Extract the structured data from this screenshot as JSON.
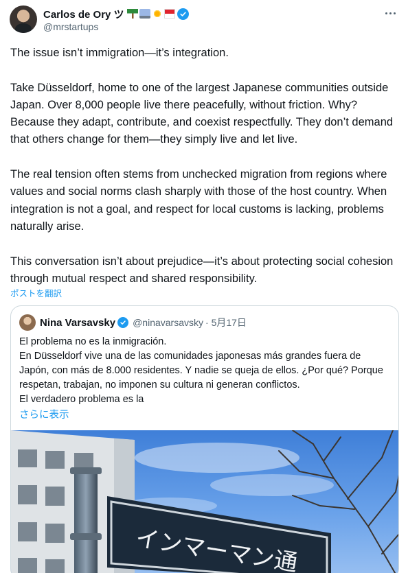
{
  "author": {
    "name": "Carlos de Ory ツ",
    "handle": "@mrstartups"
  },
  "tweet": {
    "paragraphs": [
      "The issue isn’t immigration—it’s integration.",
      "Take Düsseldorf, home to one of the largest Japanese communities outside Japan. Over 8,000 people live there peacefully, without friction. Why? Because they adapt, contribute, and coexist respectfully. They don’t demand that others change for them—they simply live and let live.",
      "The real tension often stems from unchecked migration from regions where values and social norms clash sharply with those of the host country. When integration is not a goal, and respect for local customs is lacking, problems naturally arise.",
      "This conversation isn’t about prejudice—it’s about protecting social cohesion through mutual respect and shared responsibility."
    ],
    "translate_label": "ポストを翻訳"
  },
  "quote": {
    "name": "Nina Varsavsky",
    "handle": "@ninavarsavsky",
    "date": "· 5月17日",
    "lines": [
      "El problema no es la inmigración.",
      "En Düsseldorf vive una de las comunidades japonesas más grandes fuera de Japón, con más de 8.000 residentes. Y nadie se queja de ellos. ¿Por qué? Porque respetan, trabajan, no imponen su cultura ni generan conflictos.",
      "El verdadero problema es la"
    ],
    "show_more": "さらに表示",
    "image": {
      "sign_text": "インマーマン通"
    }
  },
  "colors": {
    "accent": "#1d9bf0",
    "text": "#0f1419",
    "muted": "#536471",
    "border": "#cfd9de"
  }
}
